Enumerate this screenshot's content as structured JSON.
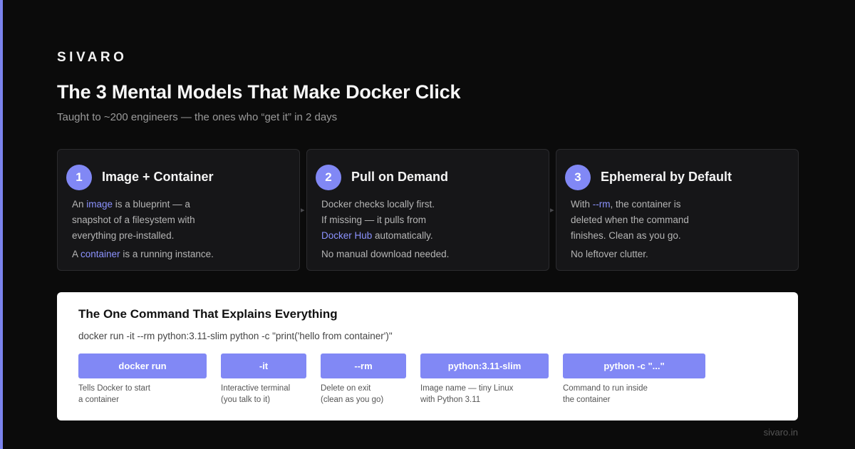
{
  "brand": "SIVARO",
  "title": "The 3 Mental Models That Make Docker Click",
  "subtitle": "Taught to ~200 engineers — the ones who “get it” in 2 days",
  "accent_color": "#7b83ee",
  "highlight_color": "#8c93ff",
  "cards": [
    {
      "number": "1",
      "title": "Image + Container",
      "line1_pre": "An ",
      "line1_hl": "image",
      "line1_post": " is a blueprint — a",
      "line2": "snapshot of a filesystem with",
      "line3": "everything pre-installed.",
      "extra_pre": "A ",
      "extra_hl": "container",
      "extra_post": " is a running instance."
    },
    {
      "number": "2",
      "title": "Pull on Demand",
      "line1": "Docker checks locally first.",
      "line2": "If missing — it pulls from",
      "line3_hl": "Docker Hub",
      "line3_post": " automatically.",
      "extra": "No manual download needed."
    },
    {
      "number": "3",
      "title": "Ephemeral by Default",
      "line1_pre": "With ",
      "line1_hl": "--rm",
      "line1_post": ", the container is",
      "line2": "deleted when the command",
      "line3": "finishes. Clean as you go.",
      "extra": "No leftover clutter."
    }
  ],
  "command": {
    "title": "The One Command That Explains Everything",
    "line": "docker run -it --rm python:3.11-slim python -c \"print('hello from container')\"",
    "parts": [
      {
        "label": "docker run",
        "desc1": "Tells Docker to start",
        "desc2": "a container"
      },
      {
        "label": "-it",
        "desc1": "Interactive terminal",
        "desc2": "(you talk to it)"
      },
      {
        "label": "--rm",
        "desc1": "Delete on exit",
        "desc2": "(clean as you go)"
      },
      {
        "label": "python:3.11-slim",
        "desc1": "Image name — tiny Linux",
        "desc2": "with Python 3.11"
      },
      {
        "label": "python -c \"...\"",
        "desc1": "Command to run inside",
        "desc2": "the container"
      }
    ]
  },
  "footer": "sivaro.in"
}
